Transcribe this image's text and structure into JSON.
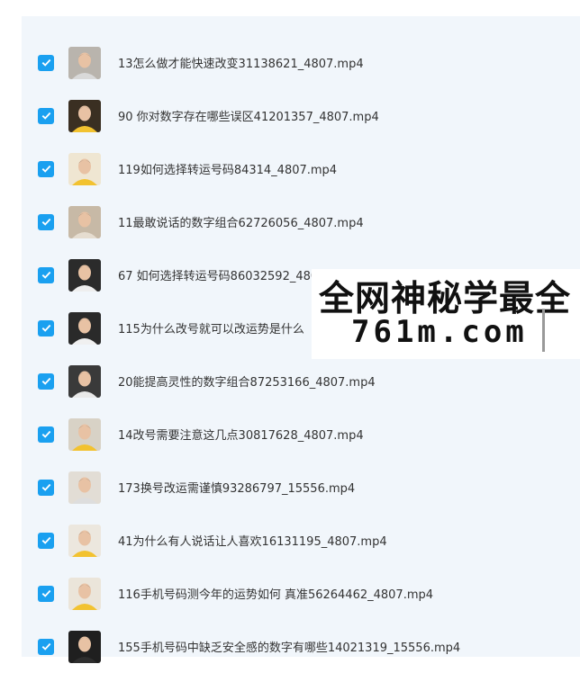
{
  "colors": {
    "checkbox": "#1aa0f0",
    "panel_background": "#f1f6fb",
    "text": "#333333"
  },
  "files": [
    {
      "name": "13怎么做才能快速改变31138621_4807.mp4",
      "checked": true,
      "thumb_bg": "#b9b4ad",
      "shirt": "#d9d9d9"
    },
    {
      "name": "90 你对数字存在哪些误区41201357_4807.mp4",
      "checked": true,
      "thumb_bg": "#3a2f22",
      "shirt": "#f2c230"
    },
    {
      "name": "119如何选择转运号码84314_4807.mp4",
      "checked": true,
      "thumb_bg": "#efe6d2",
      "shirt": "#f2c230"
    },
    {
      "name": "11最敢说话的数字组合62726056_4807.mp4",
      "checked": true,
      "thumb_bg": "#c7b9a6",
      "shirt": "#e6ddd0"
    },
    {
      "name": "67 如何选择转运号码86032592_4807.mp4",
      "checked": true,
      "thumb_bg": "#2b2b2b",
      "shirt": "#eeeeee"
    },
    {
      "name": "115为什么改号就可以改运势是什么",
      "checked": true,
      "thumb_bg": "#2a2a2a",
      "shirt": "#f0f0f0"
    },
    {
      "name": "20能提高灵性的数字组合87253166_4807.mp4",
      "checked": true,
      "thumb_bg": "#3a3a3a",
      "shirt": "#e9e9e9"
    },
    {
      "name": "14改号需要注意这几点30817628_4807.mp4",
      "checked": true,
      "thumb_bg": "#d8d2c6",
      "shirt": "#f2c230"
    },
    {
      "name": "173换号改运需谨慎93286797_15556.mp4",
      "checked": true,
      "thumb_bg": "#e2ddd5",
      "shirt": "#dddddd"
    },
    {
      "name": "41为什么有人说话让人喜欢16131195_4807.mp4",
      "checked": true,
      "thumb_bg": "#ece7de",
      "shirt": "#f2c230"
    },
    {
      "name": "116手机号码测今年的运势如何 真准56264462_4807.mp4",
      "checked": true,
      "thumb_bg": "#ebe5da",
      "shirt": "#f2c230"
    },
    {
      "name": "155手机号码中缺乏安全感的数字有哪些14021319_15556.mp4",
      "checked": true,
      "thumb_bg": "#1f1f1f",
      "shirt": "#2e2e2e"
    }
  ],
  "watermark": {
    "line1": "全网神秘学最全",
    "line2": "761m.com"
  }
}
